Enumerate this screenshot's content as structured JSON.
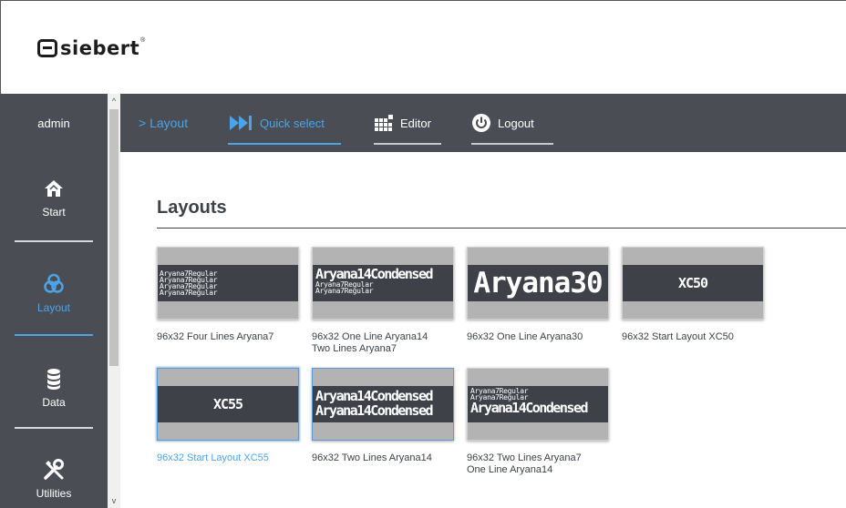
{
  "brand": {
    "name": "siebert",
    "reg": "®"
  },
  "sidebar": {
    "user": "admin",
    "items": [
      {
        "label": "Start",
        "icon": "home-icon"
      },
      {
        "label": "Layout",
        "icon": "layout-icon",
        "active": true
      },
      {
        "label": "Data",
        "icon": "database-icon"
      },
      {
        "label": "Utilities",
        "icon": "tools-icon"
      }
    ]
  },
  "scrollbar": {
    "up": "^",
    "down": "v"
  },
  "nav": {
    "breadcrumb": "> Layout",
    "quick_select": "Quick select",
    "editor": "Editor",
    "logout": "Logout"
  },
  "main": {
    "title": "Layouts",
    "tiles": [
      {
        "caption": [
          "96x32 Four Lines Aryana7"
        ],
        "lines": [
          "Aryana7Regular",
          "Aryana7Regular",
          "Aryana7Regular",
          "Aryana7Regular"
        ]
      },
      {
        "caption": [
          "96x32 One Line Aryana14",
          "Two Lines Aryana7"
        ],
        "lines": [
          "Aryana14Condensed",
          "Aryana7Regular",
          "Aryana7Regular"
        ]
      },
      {
        "caption": [
          "96x32 One Line Aryana30"
        ],
        "lines": [
          "Aryana30"
        ]
      },
      {
        "caption": [
          "96x32 Start Layout XC50"
        ],
        "lines": [
          "XC50"
        ]
      },
      {
        "caption": [
          "96x32 Start Layout XC55"
        ],
        "lines": [
          "XC55"
        ],
        "selected": true
      },
      {
        "caption": [
          "96x32 Two Lines Aryana14"
        ],
        "lines": [
          "Aryana14Condensed",
          "Aryana14Condensed"
        ]
      },
      {
        "caption": [
          "96x32 Two Lines Aryana7",
          "One Line Aryana14"
        ],
        "lines": [
          "Aryana7Regular",
          "Aryana7Regular",
          "Aryana14Condensed"
        ]
      }
    ]
  },
  "colors": {
    "accent": "#4da3e8",
    "chrome": "#4a4e54",
    "screen": "#3e4148",
    "thumb_bg": "#b3b3b3"
  }
}
